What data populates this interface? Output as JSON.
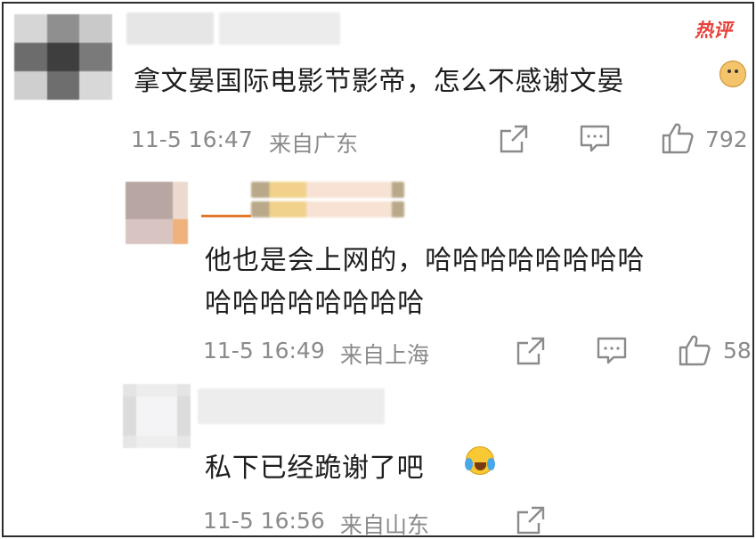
{
  "badge": {
    "hot_label": "热评"
  },
  "comments": [
    {
      "text": "拿文晏国际电影节影帝，怎么不感谢文晏",
      "emoji": "doge-emoji",
      "time": "11-5 16:47",
      "location": "来自广东",
      "likes": "792"
    },
    {
      "text_line1": "他也是会上网的，哈哈哈哈哈哈哈哈",
      "text_line2": "哈哈哈哈哈哈哈哈",
      "time": "11-5 16:49",
      "location": "来自上海",
      "likes": "58"
    },
    {
      "text": "私下已经跪谢了吧",
      "emoji": "laugh-cry-emoji",
      "time": "11-5 16:56",
      "location": "来自山东"
    }
  ],
  "colors": {
    "text": "#1e1e1e",
    "meta": "#8a8a8a",
    "hot": "#e8413a",
    "border": "#2c2c2c"
  }
}
